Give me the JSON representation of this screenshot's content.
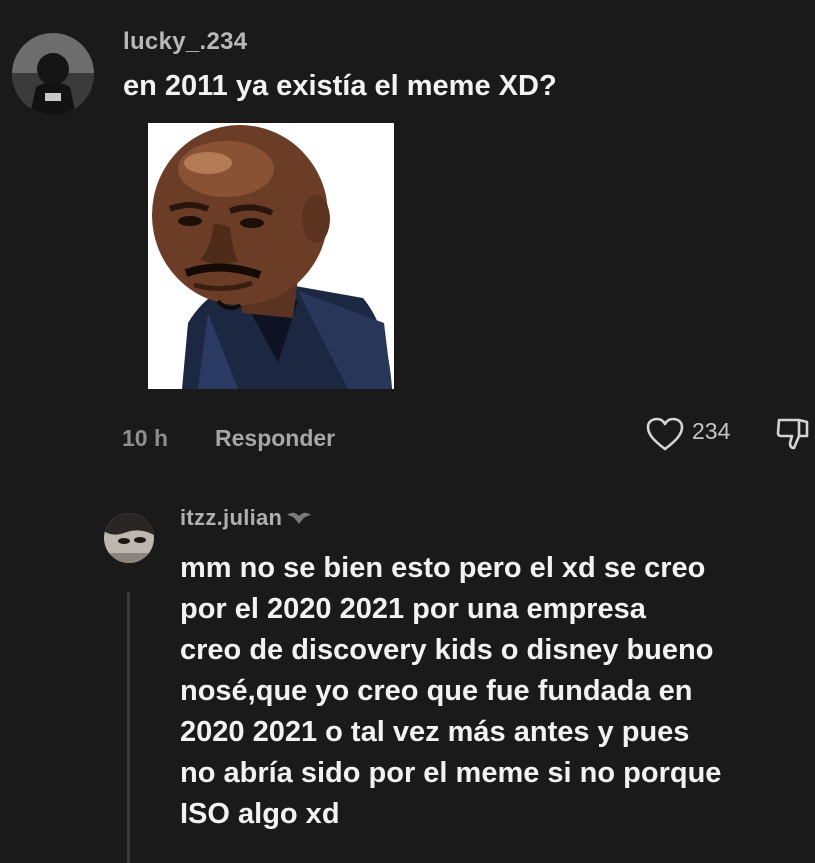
{
  "comment": {
    "username": "lucky_.234",
    "text": "en 2011 ya existía el meme XD?",
    "time": "10 h",
    "reply_label": "Responder",
    "likes": "234",
    "image_icon": "meme-face-image"
  },
  "reply": {
    "username": "itzz.julian",
    "name_badge": "bird-emoji-icon",
    "lines": [
      "mm no se bien esto pero el xd se creo",
      "por el 2020 2021 por una empresa",
      "creo de discovery kids o disney bueno",
      "nosé,que yo creo que fue fundada en",
      "2020 2021 o tal vez más antes y pues",
      "no abría sido por el meme si no porque",
      "ISO algo xd"
    ]
  },
  "colors": {
    "background": "#1a1a1a",
    "text_primary": "#f2f2f2",
    "text_muted": "#8e8e8e"
  }
}
